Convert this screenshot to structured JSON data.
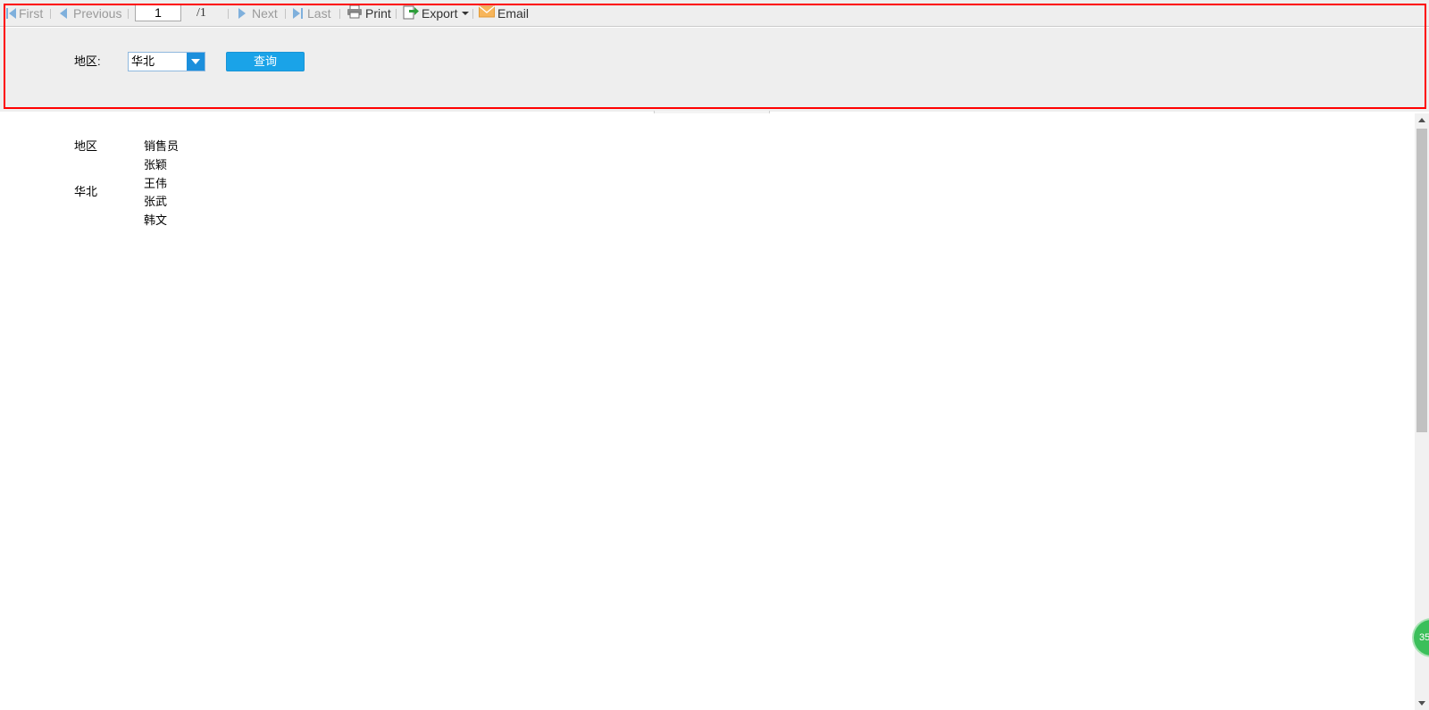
{
  "toolbar": {
    "first_label": "First",
    "previous_label": "Previous",
    "page_value": "1",
    "page_total": "/1",
    "next_label": "Next",
    "last_label": "Last",
    "print_label": "Print",
    "export_label": "Export",
    "email_label": "Email"
  },
  "params": {
    "region_label": "地区:",
    "region_selected": "华北",
    "query_button": "查询"
  },
  "report": {
    "header_region": "地区",
    "header_salesperson": "销售员",
    "region_value": "华北",
    "salespeople": [
      "张颖",
      "王伟",
      "张武",
      "韩文"
    ]
  },
  "float_badge": "35",
  "colors": {
    "toolbar_bg": "#eeeeee",
    "accent": "#1aa3e8",
    "highlight": "#ff0000"
  }
}
